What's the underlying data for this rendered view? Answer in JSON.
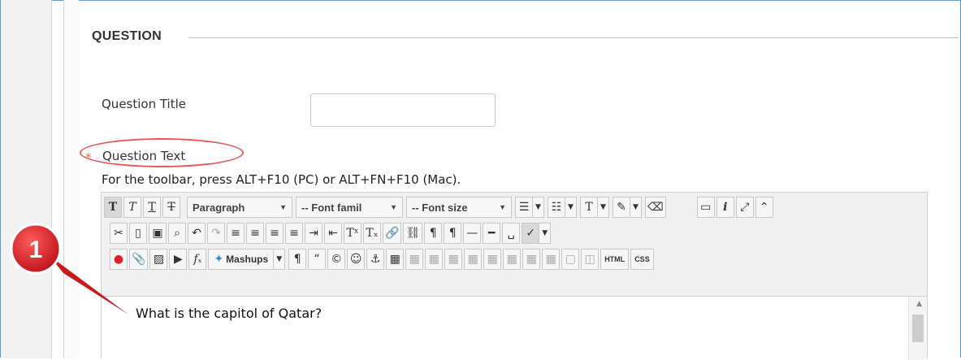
{
  "section": {
    "title": "QUESTION"
  },
  "question_title": {
    "label": "Question Title",
    "value": ""
  },
  "question_text": {
    "required_marker": "*",
    "label": "Question Text"
  },
  "hint": "For the toolbar, press ALT+F10 (PC) or ALT+FN+F10 (Mac).",
  "toolbar": {
    "row1": {
      "paragraph": "Paragraph",
      "font_family": "-- Font famil",
      "font_size": "-- Font size"
    },
    "row3": {
      "mashups": "Mashups",
      "html": "HTML",
      "css": "CSS"
    }
  },
  "editor": {
    "content": "What is the capitol of Qatar?"
  },
  "callout": {
    "number": "1",
    "color": "#e31e24"
  },
  "colors": {
    "accent": "#5b9bd5",
    "ellipse": "#e05a5a",
    "required": "#e07a3c"
  }
}
